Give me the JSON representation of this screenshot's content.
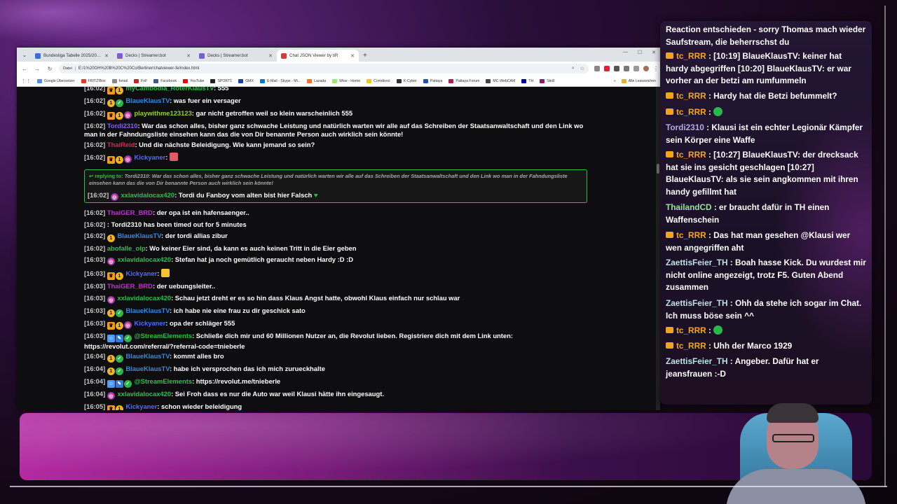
{
  "browser": {
    "tabs": [
      {
        "label": "Bundesliga Tabelle 2025/2026 | ...",
        "fav": "#3a6fd8",
        "active": false
      },
      {
        "label": "Decks | Streamer.bot",
        "fav": "#7b5cd6",
        "active": false
      },
      {
        "label": "Decks | Streamer.bot",
        "fav": "#7b5cd6",
        "active": false
      },
      {
        "label": "Chat JSON Viewer by tiR",
        "fav": "#d83a3a",
        "active": true
      }
    ],
    "address_chip": "Datei",
    "address": "E:/1%20OH%20B%20C%20Co/Berliner/chatviewer-fe/index.html",
    "bookmarks": [
      {
        "label": "Google Übersetzer",
        "color": "#4a8af4"
      },
      {
        "label": "FRITZ!Box",
        "color": "#e23b2e"
      },
      {
        "label": "fonial",
        "color": "#888888"
      },
      {
        "label": "FoF",
        "color": "#cc2222"
      },
      {
        "label": "Facebook",
        "color": "#3b5998"
      },
      {
        "label": "YouTube",
        "color": "#ff0000"
      },
      {
        "label": "SPORT1",
        "color": "#222222"
      },
      {
        "label": "GMX",
        "color": "#1c449b"
      },
      {
        "label": "E-Mail - Skype - Mi...",
        "color": "#0078d4"
      },
      {
        "label": "Lazada",
        "color": "#f57224"
      },
      {
        "label": "Wise - Home",
        "color": "#9fe870"
      },
      {
        "label": "Comdirect",
        "color": "#f5c518"
      },
      {
        "label": "K-Cyber",
        "color": "#333333"
      },
      {
        "label": "Pattaya",
        "color": "#2255aa"
      },
      {
        "label": "Pattaya Forum",
        "color": "#aa2255"
      },
      {
        "label": "MC-WebCAM",
        "color": "#444444"
      },
      {
        "label": "TH",
        "color": "#00a"
      },
      {
        "label": "Skrill",
        "color": "#862165"
      }
    ],
    "bookmarks_right": "Alle Lesezeichen"
  },
  "chat": [
    {
      "ts": "[16:02]",
      "badges": [
        "crown",
        "gold"
      ],
      "user": "myCambodia_RoterKlausTV",
      "color": "#27c247",
      "text": ": 555"
    },
    {
      "ts": "[16:02]",
      "badges": [
        "gold",
        "green"
      ],
      "user": "BlaueKlausTV",
      "color": "#2f8be5",
      "text": ": was fuer ein versager"
    },
    {
      "ts": "[16:02]",
      "badges": [
        "crown",
        "gold",
        "globe"
      ],
      "user": "playwithme123123",
      "color": "#9acd32",
      "text": ": gar nicht getroffen weil so klein warscheinlich 555"
    },
    {
      "ts": "[16:02]",
      "badges": [],
      "user": "Tordi2310",
      "color": "#8a5cf5",
      "text": ": War das schon alles, bisher ganz schwache Leistung und natürlich warten wir alle auf das Schreiben der Staatsanwaltschaft und den Link wo man in der Fahndungsliste einsehen kann das die von Dir benannte Person auch wirklich sein könnte!"
    },
    {
      "ts": "[16:02]",
      "badges": [],
      "user": "ThaiReid",
      "color": "#e0235b",
      "text": ": Und die nächste Beleidigung. Wie kann jemand so sein?"
    },
    {
      "ts": "[16:02]",
      "badges": [
        "crown",
        "gold",
        "globe"
      ],
      "user": "Kickyaner",
      "color": "#4d6bff",
      "text": ":"
    },
    {
      "ts": "[16:02]",
      "badges": [],
      "user": "ThaiGER_BRD",
      "color": "#c12fd1",
      "text": ": der opa ist ein hafensaenger.."
    },
    {
      "ts": "[16:02]",
      "badges": [],
      "user": "",
      "color": "#ffffff",
      "text": ": Tordi2310 has been timed out for 5 minutes"
    },
    {
      "ts": "[16:02]",
      "badges": [
        "gold"
      ],
      "user": "BlaueKlausTV",
      "color": "#2f8be5",
      "text": ": der tordi allias zibur"
    },
    {
      "ts": "[16:02]",
      "badges": [],
      "user": "abofalle_olp",
      "color": "#27c247",
      "text": ": Wo keiner Eier sind, da kann es auch keinen Tritt in die Eier geben"
    },
    {
      "ts": "[16:03]",
      "badges": [
        "globe"
      ],
      "user": "xxlavidalocax420",
      "color": "#27c247",
      "text": ": Stefan hat ja noch gemütlich geraucht neben Hardy :D :D"
    },
    {
      "ts": "[16:03]",
      "badges": [
        "crown",
        "gold"
      ],
      "user": "Kickyaner",
      "color": "#4d6bff",
      "text": ":"
    },
    {
      "ts": "[16:03]",
      "badges": [],
      "user": "ThaiGER_BRD",
      "color": "#c12fd1",
      "text": ": der uebungsleiter.."
    },
    {
      "ts": "[16:03]",
      "badges": [
        "globe"
      ],
      "user": "xxlavidalocax420",
      "color": "#27c247",
      "text": ": Schau jetzt dreht er es so hin dass Klaus Angst hatte, obwohl Klaus einfach nur schlau war"
    },
    {
      "ts": "[16:03]",
      "badges": [
        "gold",
        "green"
      ],
      "user": "BlaueKlausTV",
      "color": "#2f8be5",
      "text": ": ich habe nie eine frau zu dir geschick sato"
    },
    {
      "ts": "[16:03]",
      "badges": [
        "crown",
        "gold",
        "globe"
      ],
      "user": "Kickyaner",
      "color": "#4d6bff",
      "text": ": opa der schläger 555"
    },
    {
      "ts": "[16:03]",
      "badges": [
        "bot",
        "tool",
        "green"
      ],
      "user": "@StreamElements",
      "color": "#27c247",
      "text": ": Schließe dich mir und 60 Millionen Nutzer an, die Revolut lieben. Registriere dich mit dem Link unten: https://revolut.com/referral/?referral-code=tnieberle"
    },
    {
      "ts": "[16:04]",
      "badges": [
        "gold",
        "green"
      ],
      "user": "BlaueKlausTV",
      "color": "#2f8be5",
      "text": ": kommt alles bro"
    },
    {
      "ts": "[16:04]",
      "badges": [
        "gold",
        "green"
      ],
      "user": "BlaueKlausTV",
      "color": "#2f8be5",
      "text": ": habe ich versprochen das ich mich zurueckhalte"
    },
    {
      "ts": "[16:04]",
      "badges": [
        "bot",
        "tool",
        "green"
      ],
      "user": "@StreamElements",
      "color": "#27c247",
      "text": ": https://revolut.me/tnieberle"
    },
    {
      "ts": "[16:04]",
      "badges": [
        "globe"
      ],
      "user": "xxlavidalocax420",
      "color": "#27c247",
      "text": ": Sei Froh dass es nur die Auto war weil Klausi hätte ihn eingesaugt."
    },
    {
      "ts": "[16:05]",
      "badges": [
        "crown",
        "gold"
      ],
      "user": "Kickyaner",
      "color": "#4d6bff",
      "text": ": schon wieder beleidigung"
    }
  ],
  "reply": {
    "replying_label": "replying to:",
    "quoted": "Tordi2310: War das schon alles, bisher ganz schwache Leistung und natürlich warten wir alle auf das Schreiben der Staatsanwaltschaft und den Link wo man in der Fahndungsliste einsehen kann das die von Dir benannte Person auch wirklich sein könnte!",
    "ts": "[16:02]",
    "user": "xxlavidalocax420",
    "text": ": Tordi du Fanboy vom alten bist hier Falsch"
  },
  "overlay": [
    {
      "badge": false,
      "user": "",
      "color": "#ffffff",
      "text": "Reaction entschieden - sorry Thomas mach wieder Saufstream, die beherrschst du"
    },
    {
      "badge": true,
      "user": "tc_RRR",
      "color": "#f5a623",
      "text": ": [10:19] BlaueKlausTV: keiner hat hardy abgegriffen [10:20] BlaueKlausTV: er war vorher an der betzi am rumfummeln"
    },
    {
      "badge": true,
      "user": "tc_RRR",
      "color": "#f5a623",
      "text": ": Hardy hat die Betzi befummelt?"
    },
    {
      "badge": true,
      "user": "tc_RRR",
      "color": "#f5a623",
      "text": ":",
      "emote": true
    },
    {
      "badge": false,
      "user": "Tordi2310",
      "color": "#b9a7e8",
      "text": ": Klausi ist ein echter Legionär Kämpfer sein Körper eine Waffe"
    },
    {
      "badge": true,
      "user": "tc_RRR",
      "color": "#f5a623",
      "text": ": [10:27] BlaueKlausTV: der drecksack hat sie ins gesicht geschlagen [10:27] BlaueKlausTV: als sie sein angkommen mit ihren handy gefillmt hat"
    },
    {
      "badge": false,
      "user": "ThailandCD",
      "color": "#9be0a0",
      "text": ": er braucht dafür in TH einen Waffenschein"
    },
    {
      "badge": true,
      "user": "tc_RRR",
      "color": "#f5a623",
      "text": ": Das hat man gesehen @Klausi wer wen angegriffen aht"
    },
    {
      "badge": false,
      "user": "ZaettisFeier_TH",
      "color": "#bde3e8",
      "text": ": Boah hasse Kick. Du wurdest mir nicht online angezeigt, trotz F5. Guten Abend zusammen"
    },
    {
      "badge": false,
      "user": "ZaettisFeier_TH",
      "color": "#bde3e8",
      "text": ": Ohh da stehe ich sogar im Chat. Ich muss böse sein ^^"
    },
    {
      "badge": true,
      "user": "tc_RRR",
      "color": "#f5a623",
      "text": ":",
      "emote": true
    },
    {
      "badge": true,
      "user": "tc_RRR",
      "color": "#f5a623",
      "text": ": Uhh der Marco 1929"
    },
    {
      "badge": false,
      "user": "ZaettisFeier_TH",
      "color": "#bde3e8",
      "text": ": Angeber. Dafür hat er jeansfrauen :-D"
    }
  ]
}
